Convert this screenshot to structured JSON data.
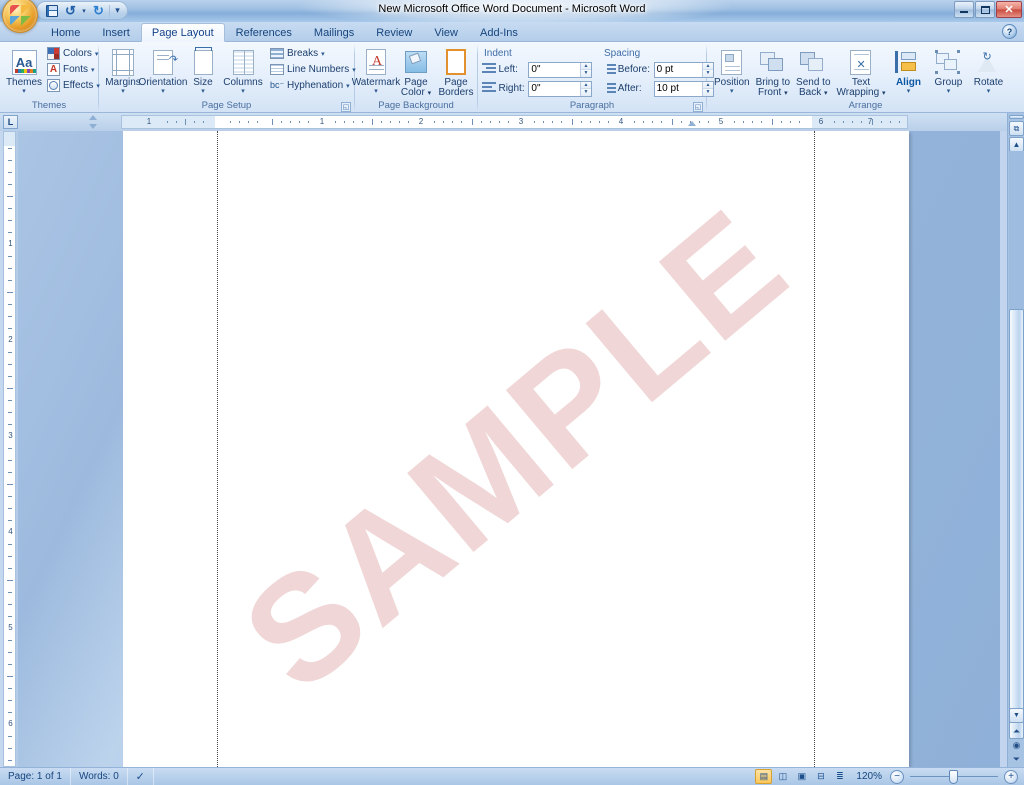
{
  "window": {
    "title": "New Microsoft Office Word Document - Microsoft Word",
    "office_button": "office-orb",
    "minimize": "—",
    "maximize": "❐",
    "close": "✕",
    "help": "?"
  },
  "quick_access": {
    "save": "save-icon",
    "undo": "↺",
    "undo_caret": "▾",
    "redo": "↻",
    "customize": "▾"
  },
  "tabs": [
    {
      "label": "Home",
      "active": false
    },
    {
      "label": "Insert",
      "active": false
    },
    {
      "label": "Page Layout",
      "active": true
    },
    {
      "label": "References",
      "active": false
    },
    {
      "label": "Mailings",
      "active": false
    },
    {
      "label": "Review",
      "active": false
    },
    {
      "label": "View",
      "active": false
    },
    {
      "label": "Add-Ins",
      "active": false
    }
  ],
  "ribbon": {
    "groups": [
      {
        "name": "Themes",
        "label": "Themes",
        "big": [
          {
            "label": "Themes",
            "label2": "",
            "dropdown": "▾",
            "icon": "themes-icon"
          }
        ],
        "small": [
          {
            "label": "Colors",
            "dropdown": "▾",
            "icon": "theme-colors-icon"
          },
          {
            "label": "Fonts",
            "dropdown": "▾",
            "icon": "theme-fonts-icon"
          },
          {
            "label": "Effects",
            "dropdown": "▾",
            "icon": "theme-effects-icon"
          }
        ]
      },
      {
        "name": "Page Setup",
        "label": "Page Setup",
        "launcher": "◱",
        "big": [
          {
            "label": "Margins",
            "label2": "",
            "dropdown": "▾",
            "icon": "margins-icon"
          },
          {
            "label": "Orientation",
            "label2": "",
            "dropdown": "▾",
            "icon": "orientation-icon"
          },
          {
            "label": "Size",
            "label2": "",
            "dropdown": "▾",
            "icon": "size-icon"
          },
          {
            "label": "Columns",
            "label2": "",
            "dropdown": "▾",
            "icon": "columns-icon"
          }
        ],
        "small": [
          {
            "label": "Breaks",
            "dropdown": "▾",
            "icon": "breaks-icon"
          },
          {
            "label": "Line Numbers",
            "dropdown": "▾",
            "icon": "line-numbers-icon"
          },
          {
            "label": "Hyphenation",
            "dropdown": "▾",
            "icon": "hyphenation-icon"
          }
        ]
      },
      {
        "name": "Page Background",
        "label": "Page Background",
        "big": [
          {
            "label": "Watermark",
            "label2": "",
            "dropdown": "▾",
            "icon": "watermark-icon"
          },
          {
            "label": "Page",
            "label2": "Color",
            "dropdown": "▾",
            "icon": "page-color-icon"
          },
          {
            "label": "Page",
            "label2": "Borders",
            "dropdown": "",
            "icon": "page-borders-icon"
          }
        ]
      },
      {
        "name": "Paragraph",
        "label": "Paragraph",
        "launcher": "◱",
        "indent_header": "Indent",
        "spacing_header": "Spacing",
        "fields": [
          {
            "label": "Left:",
            "value": "0\"",
            "name": "indent-left"
          },
          {
            "label": "Right:",
            "value": "0\"",
            "name": "indent-right"
          },
          {
            "label": "Before:",
            "value": "0 pt",
            "name": "spacing-before"
          },
          {
            "label": "After:",
            "value": "10 pt",
            "name": "spacing-after"
          }
        ]
      },
      {
        "name": "Arrange",
        "label": "Arrange",
        "big": [
          {
            "label": "Position",
            "label2": "",
            "dropdown": "▾",
            "icon": "position-icon",
            "hot": false
          },
          {
            "label": "Bring to",
            "label2": "Front",
            "dropdown": "▾",
            "icon": "bring-to-front-icon",
            "hot": false
          },
          {
            "label": "Send to",
            "label2": "Back",
            "dropdown": "▾",
            "icon": "send-to-back-icon",
            "hot": false
          },
          {
            "label": "Text",
            "label2": "Wrapping",
            "dropdown": "▾",
            "icon": "text-wrapping-icon",
            "hot": false
          },
          {
            "label": "Align",
            "label2": "",
            "dropdown": "▾",
            "icon": "align-icon",
            "hot": true
          },
          {
            "label": "Group",
            "label2": "",
            "dropdown": "▾",
            "icon": "group-icon",
            "hot": false
          },
          {
            "label": "Rotate",
            "label2": "",
            "dropdown": "▾",
            "icon": "rotate-icon",
            "hot": false
          }
        ]
      }
    ]
  },
  "ruler": {
    "tab_selector": "L",
    "h_numbers": [
      "1",
      "1",
      "2",
      "3",
      "4",
      "5",
      "6",
      "7"
    ],
    "v_numbers": [
      "1",
      "2",
      "3",
      "4",
      "5",
      "6"
    ]
  },
  "document": {
    "watermark_text": "SAMPLE",
    "watermark_color": "#f0d6d6",
    "page_background": "#ffffff"
  },
  "status_bar": {
    "page": "Page: 1 of 1",
    "words": "Words: 0",
    "proofing": "proofing-icon",
    "views": [
      {
        "name": "print-layout-view",
        "glyph": "▤",
        "active": true
      },
      {
        "name": "full-screen-reading-view",
        "glyph": "◫",
        "active": false
      },
      {
        "name": "web-layout-view",
        "glyph": "▣",
        "active": false
      },
      {
        "name": "outline-view",
        "glyph": "⊟",
        "active": false
      },
      {
        "name": "draft-view",
        "glyph": "≣",
        "active": false
      }
    ],
    "zoom": "120%",
    "zoom_out": "−",
    "zoom_in": "+"
  },
  "scrollbar": {
    "split_handle": "▬",
    "up_arrow": "▲",
    "down_arrow": "▼",
    "prev_page": "⏶",
    "select_browse_object": "◉",
    "next_page": "⏷"
  }
}
